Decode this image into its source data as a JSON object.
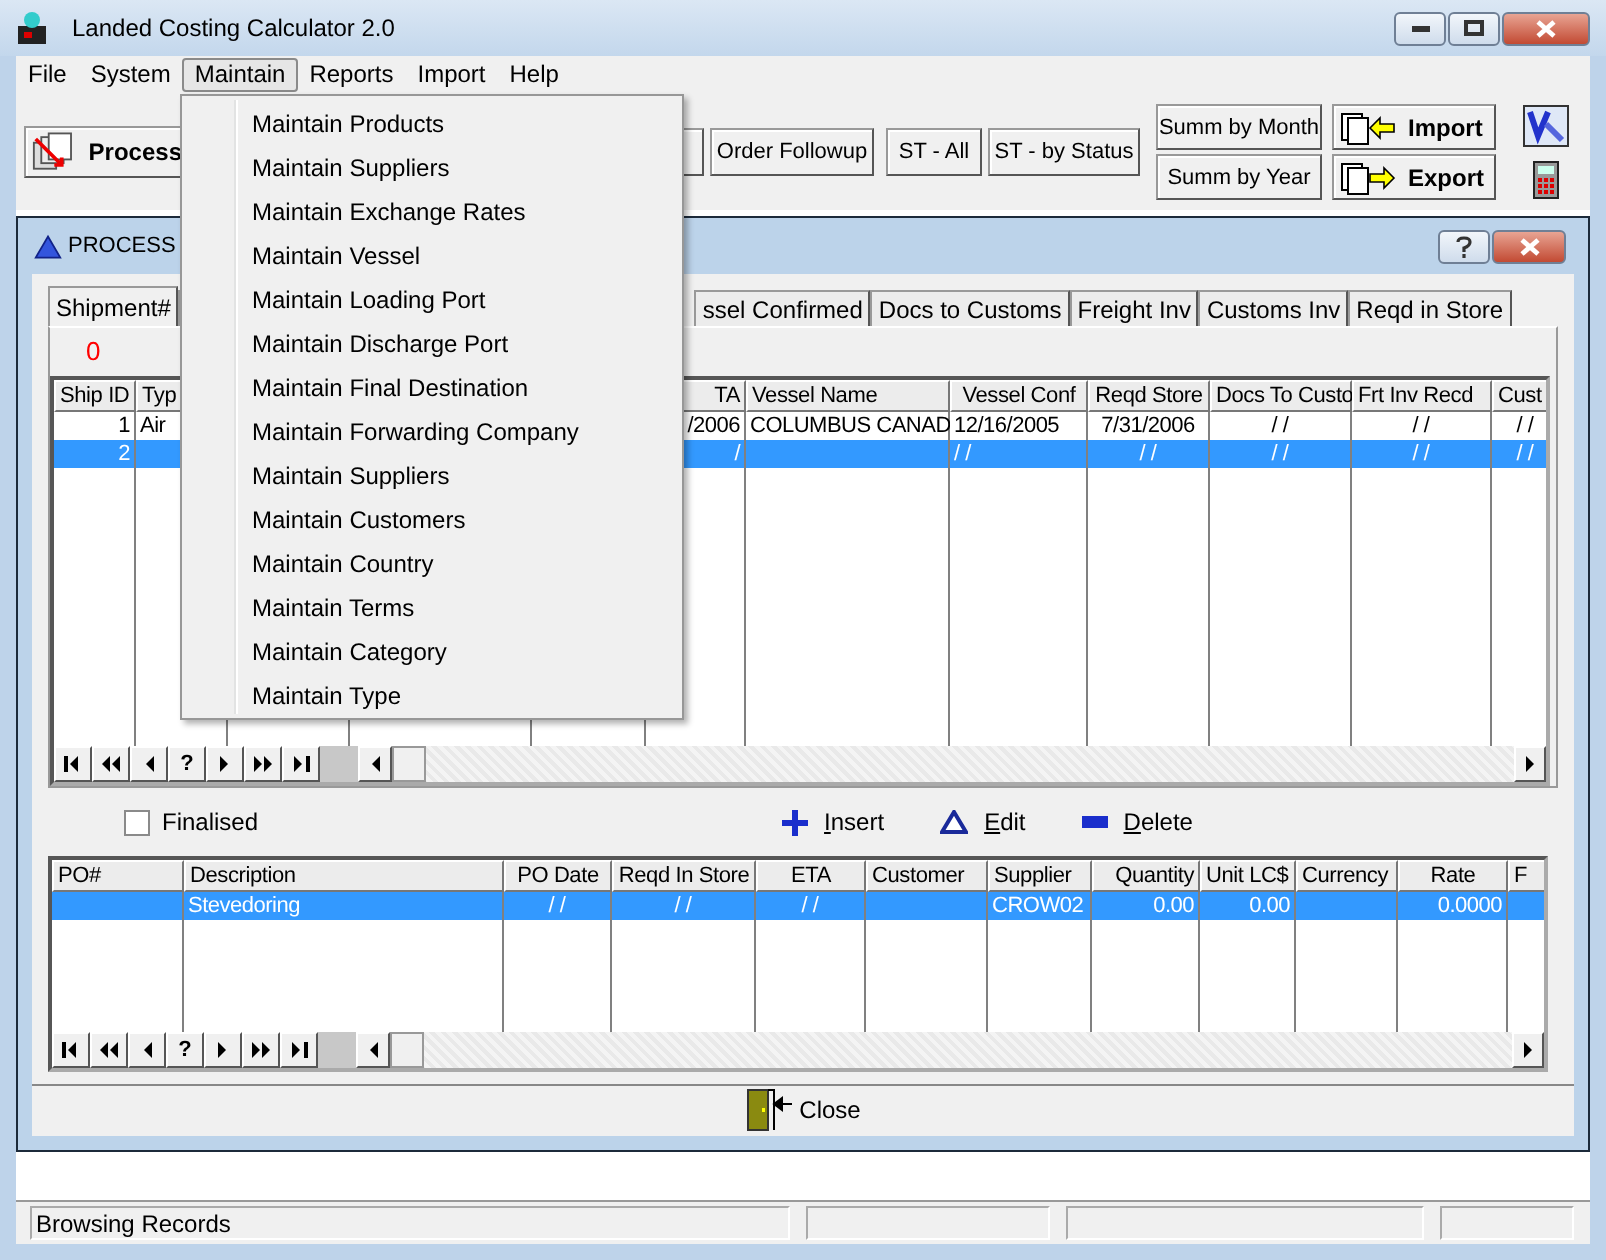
{
  "window": {
    "title": "Landed Costing Calculator 2.0"
  },
  "menu_bar": [
    {
      "label": "File",
      "selected": false
    },
    {
      "label": "System",
      "selected": false
    },
    {
      "label": "Maintain",
      "selected": true
    },
    {
      "label": "Reports",
      "selected": false
    },
    {
      "label": "Import",
      "selected": false
    },
    {
      "label": "Help",
      "selected": false
    }
  ],
  "open_menu": {
    "items": [
      "Maintain Products",
      "Maintain Suppliers",
      "Maintain Exchange Rates",
      "Maintain Vessel",
      "Maintain Loading Port",
      "Maintain Discharge Port",
      "Maintain Final Destination",
      "Maintain Forwarding Company",
      "Maintain Suppliers",
      "Maintain Customers",
      "Maintain Country",
      "Maintain Terms",
      "Maintain Category",
      "Maintain Type"
    ]
  },
  "toolbar": {
    "process": "Process",
    "buttons": [
      "Order Followup",
      "ST - All",
      "ST - by Status"
    ],
    "summary_buttons": [
      "Summ by Month",
      "Summ by Year"
    ],
    "transfer_buttons": [
      {
        "kind": "import",
        "label": "Import"
      },
      {
        "kind": "export",
        "label": "Export"
      }
    ]
  },
  "process_window": {
    "title": "PROCESS",
    "tabs": [
      {
        "label": "Shipment#",
        "selected": true
      },
      {
        "label": "ssel Confirmed",
        "selected": false
      },
      {
        "label": "Docs to Customs",
        "selected": false
      },
      {
        "label": "Freight Inv",
        "selected": false
      },
      {
        "label": "Customs Inv",
        "selected": false
      },
      {
        "label": "Reqd in Store",
        "selected": false
      }
    ],
    "counter": "0",
    "shipments": {
      "columns": [
        "Ship ID",
        "Typ",
        "TA",
        "Vessel Name",
        "Vessel Conf",
        "Reqd Store",
        "Docs To Custo",
        "Frt Inv Recd",
        "Cust"
      ],
      "rows": [
        {
          "selected": false,
          "cells": [
            "1",
            "Air",
            "/2006",
            "COLUMBUS CANAD",
            "12/16/2005",
            "7/31/2006",
            "/ /",
            "/ /",
            "/ /"
          ]
        },
        {
          "selected": true,
          "cells": [
            "2",
            "",
            "/",
            "",
            "/ /",
            "/ /",
            "/ /",
            "/ /",
            "/ /"
          ]
        }
      ]
    },
    "navigator_help": "?",
    "finalised": {
      "label": "Finalised",
      "checked": false
    },
    "actions": [
      {
        "kind": "insert",
        "label": "Insert"
      },
      {
        "kind": "edit",
        "label": "Edit"
      },
      {
        "kind": "delete",
        "label": "Delete"
      }
    ],
    "lines": {
      "columns": [
        "PO#",
        "Description",
        "PO Date",
        "Reqd In Store",
        "ETA",
        "Customer",
        "Supplier",
        "Quantity",
        "Unit LC$",
        "Currency",
        "Rate",
        "F"
      ],
      "rows": [
        {
          "selected": true,
          "cells": [
            "",
            "Stevedoring",
            "/ /",
            "/ /",
            "/ /",
            "",
            "CROW02",
            "0.00",
            "0.00",
            "",
            "0.0000",
            ""
          ]
        }
      ]
    },
    "close_button": "Close"
  },
  "status_bar": {
    "text": "Browsing Records"
  }
}
